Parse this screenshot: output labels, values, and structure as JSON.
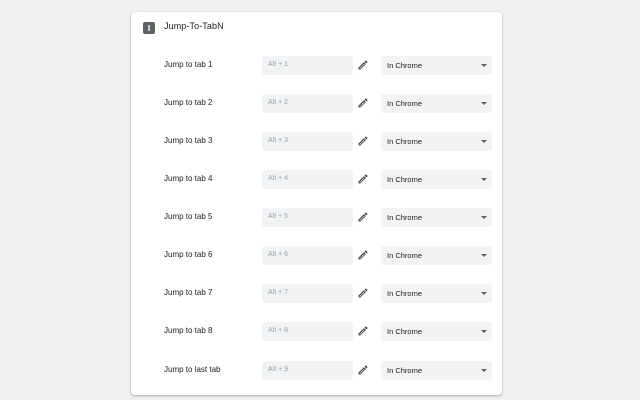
{
  "extension": {
    "title": "Jump-To-TabN",
    "icon": "extension-icon"
  },
  "rows": [
    {
      "label": "Jump to tab 1",
      "shortcut": "Alt + 1",
      "scope": "In Chrome"
    },
    {
      "label": "Jump to tab 2",
      "shortcut": "Alt + 2",
      "scope": "In Chrome"
    },
    {
      "label": "Jump to tab 3",
      "shortcut": "Alt + 3",
      "scope": "In Chrome"
    },
    {
      "label": "Jump to tab 4",
      "shortcut": "Alt + 4",
      "scope": "In Chrome"
    },
    {
      "label": "Jump to tab 5",
      "shortcut": "Alt + 5",
      "scope": "In Chrome"
    },
    {
      "label": "Jump to tab 6",
      "shortcut": "Alt + 6",
      "scope": "In Chrome"
    },
    {
      "label": "Jump to tab 7",
      "shortcut": "Alt + 7",
      "scope": "In Chrome"
    },
    {
      "label": "Jump to tab 8",
      "shortcut": "Alt + 8",
      "scope": "In Chrome"
    },
    {
      "label": "Jump to last tab",
      "shortcut": "Alt + 9",
      "scope": "In Chrome"
    }
  ],
  "icons": {
    "edit": "pencil-icon",
    "dropdown": "caret-down-icon"
  },
  "colors": {
    "background": "#f1f1f1",
    "card": "#ffffff",
    "field": "#f1f3f4",
    "text": "#202124",
    "placeholder": "#9aa0a6"
  }
}
